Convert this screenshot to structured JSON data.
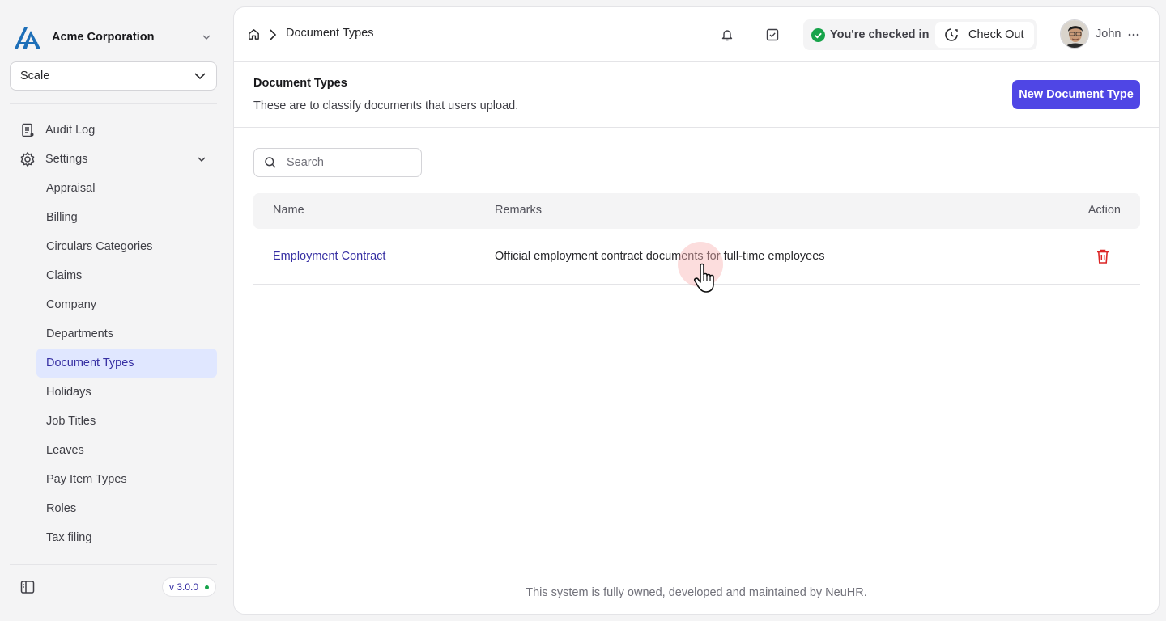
{
  "org": {
    "name": "Acme Corporation"
  },
  "workspace_select": {
    "value": "Scale"
  },
  "nav": {
    "audit_log": "Audit Log",
    "settings": "Settings",
    "settings_items": [
      "Appraisal",
      "Billing",
      "Circulars Categories",
      "Claims",
      "Company",
      "Departments",
      "Document Types",
      "Holidays",
      "Job Titles",
      "Leaves",
      "Pay Item Types",
      "Roles",
      "Tax filing"
    ],
    "active_item": "Document Types"
  },
  "version": "v 3.0.0",
  "breadcrumb": {
    "current": "Document Types"
  },
  "status": {
    "checked_in": "You're checked in",
    "check_out_label": "Check Out"
  },
  "user": {
    "name": "John"
  },
  "page": {
    "title": "Document Types",
    "description": "These are to classify documents that users upload.",
    "new_button": "New Document Type"
  },
  "search": {
    "placeholder": "Search",
    "value": ""
  },
  "table": {
    "columns": {
      "name": "Name",
      "remarks": "Remarks",
      "action": "Action"
    },
    "rows": [
      {
        "name": "Employment Contract",
        "remarks": "Official employment contract documents for full-time employees"
      }
    ]
  },
  "footer": "This system is fully owned, developed and maintained by NeuHR.",
  "colors": {
    "accent": "#4f46e5",
    "active_bg": "#e0e7ff",
    "success": "#16a34a",
    "danger": "#dc2626"
  }
}
